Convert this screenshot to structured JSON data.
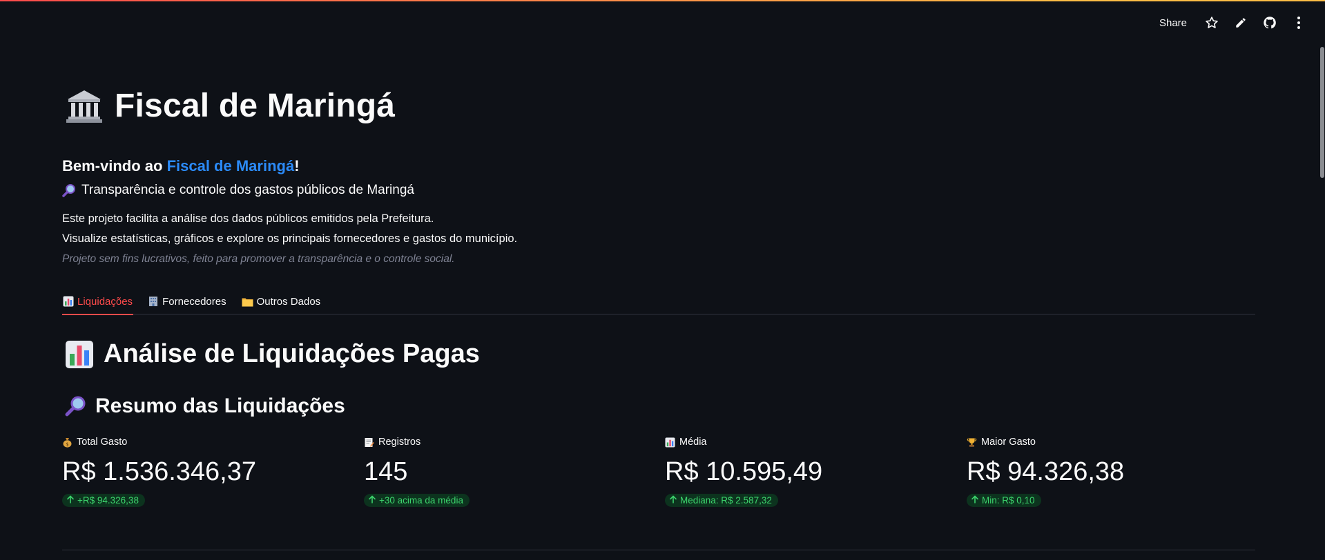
{
  "toolbar": {
    "share_label": "Share",
    "icons": [
      "star-icon",
      "pencil-icon",
      "github-icon",
      "kebab-menu-icon"
    ]
  },
  "header": {
    "title_icon": "bank-building-icon",
    "title": "Fiscal de Maringá"
  },
  "intro": {
    "welcome_prefix": "Bem-vindo ao ",
    "welcome_brand": "Fiscal de Maringá",
    "welcome_suffix": "!",
    "tagline_icon": "magnifier-icon",
    "tagline": "Transparência e controle dos gastos públicos de Maringá",
    "description_line1": "Este projeto facilita a análise dos dados públicos emitidos pela Prefeitura.",
    "description_line2": "Visualize estatísticas, gráficos e explore os principais fornecedores e gastos do município.",
    "note": "Projeto sem fins lucrativos, feito para promover a transparência e o controle social."
  },
  "tabs": [
    {
      "label": "Liquidações",
      "icon": "bar-chart-icon",
      "active": true
    },
    {
      "label": "Fornecedores",
      "icon": "office-building-icon",
      "active": false
    },
    {
      "label": "Outros Dados",
      "icon": "folder-icon",
      "active": false
    }
  ],
  "section": {
    "title_icon": "bar-chart-icon",
    "title": "Análise de Liquidações Pagas",
    "subtitle_icon": "magnifier-icon",
    "subtitle": "Resumo das Liquidações"
  },
  "metrics": [
    {
      "icon": "money-bag-icon",
      "label": "Total Gasto",
      "value": "R$ 1.536.346,37",
      "delta": "+R$ 94.326,38"
    },
    {
      "icon": "memo-icon",
      "label": "Registros",
      "value": "145",
      "delta": "+30 acima da média"
    },
    {
      "icon": "bar-chart-icon",
      "label": "Média",
      "value": "R$ 10.595,49",
      "delta": "Mediana: R$ 2.587,32"
    },
    {
      "icon": "trophy-icon",
      "label": "Maior Gasto",
      "value": "R$ 94.326,38",
      "delta": "Min: R$ 0,10"
    }
  ],
  "colors": {
    "background": "#0e1117",
    "accent": "#ff4b4b",
    "brand_link": "#2b8af7",
    "delta_positive": "#3dd56d"
  }
}
